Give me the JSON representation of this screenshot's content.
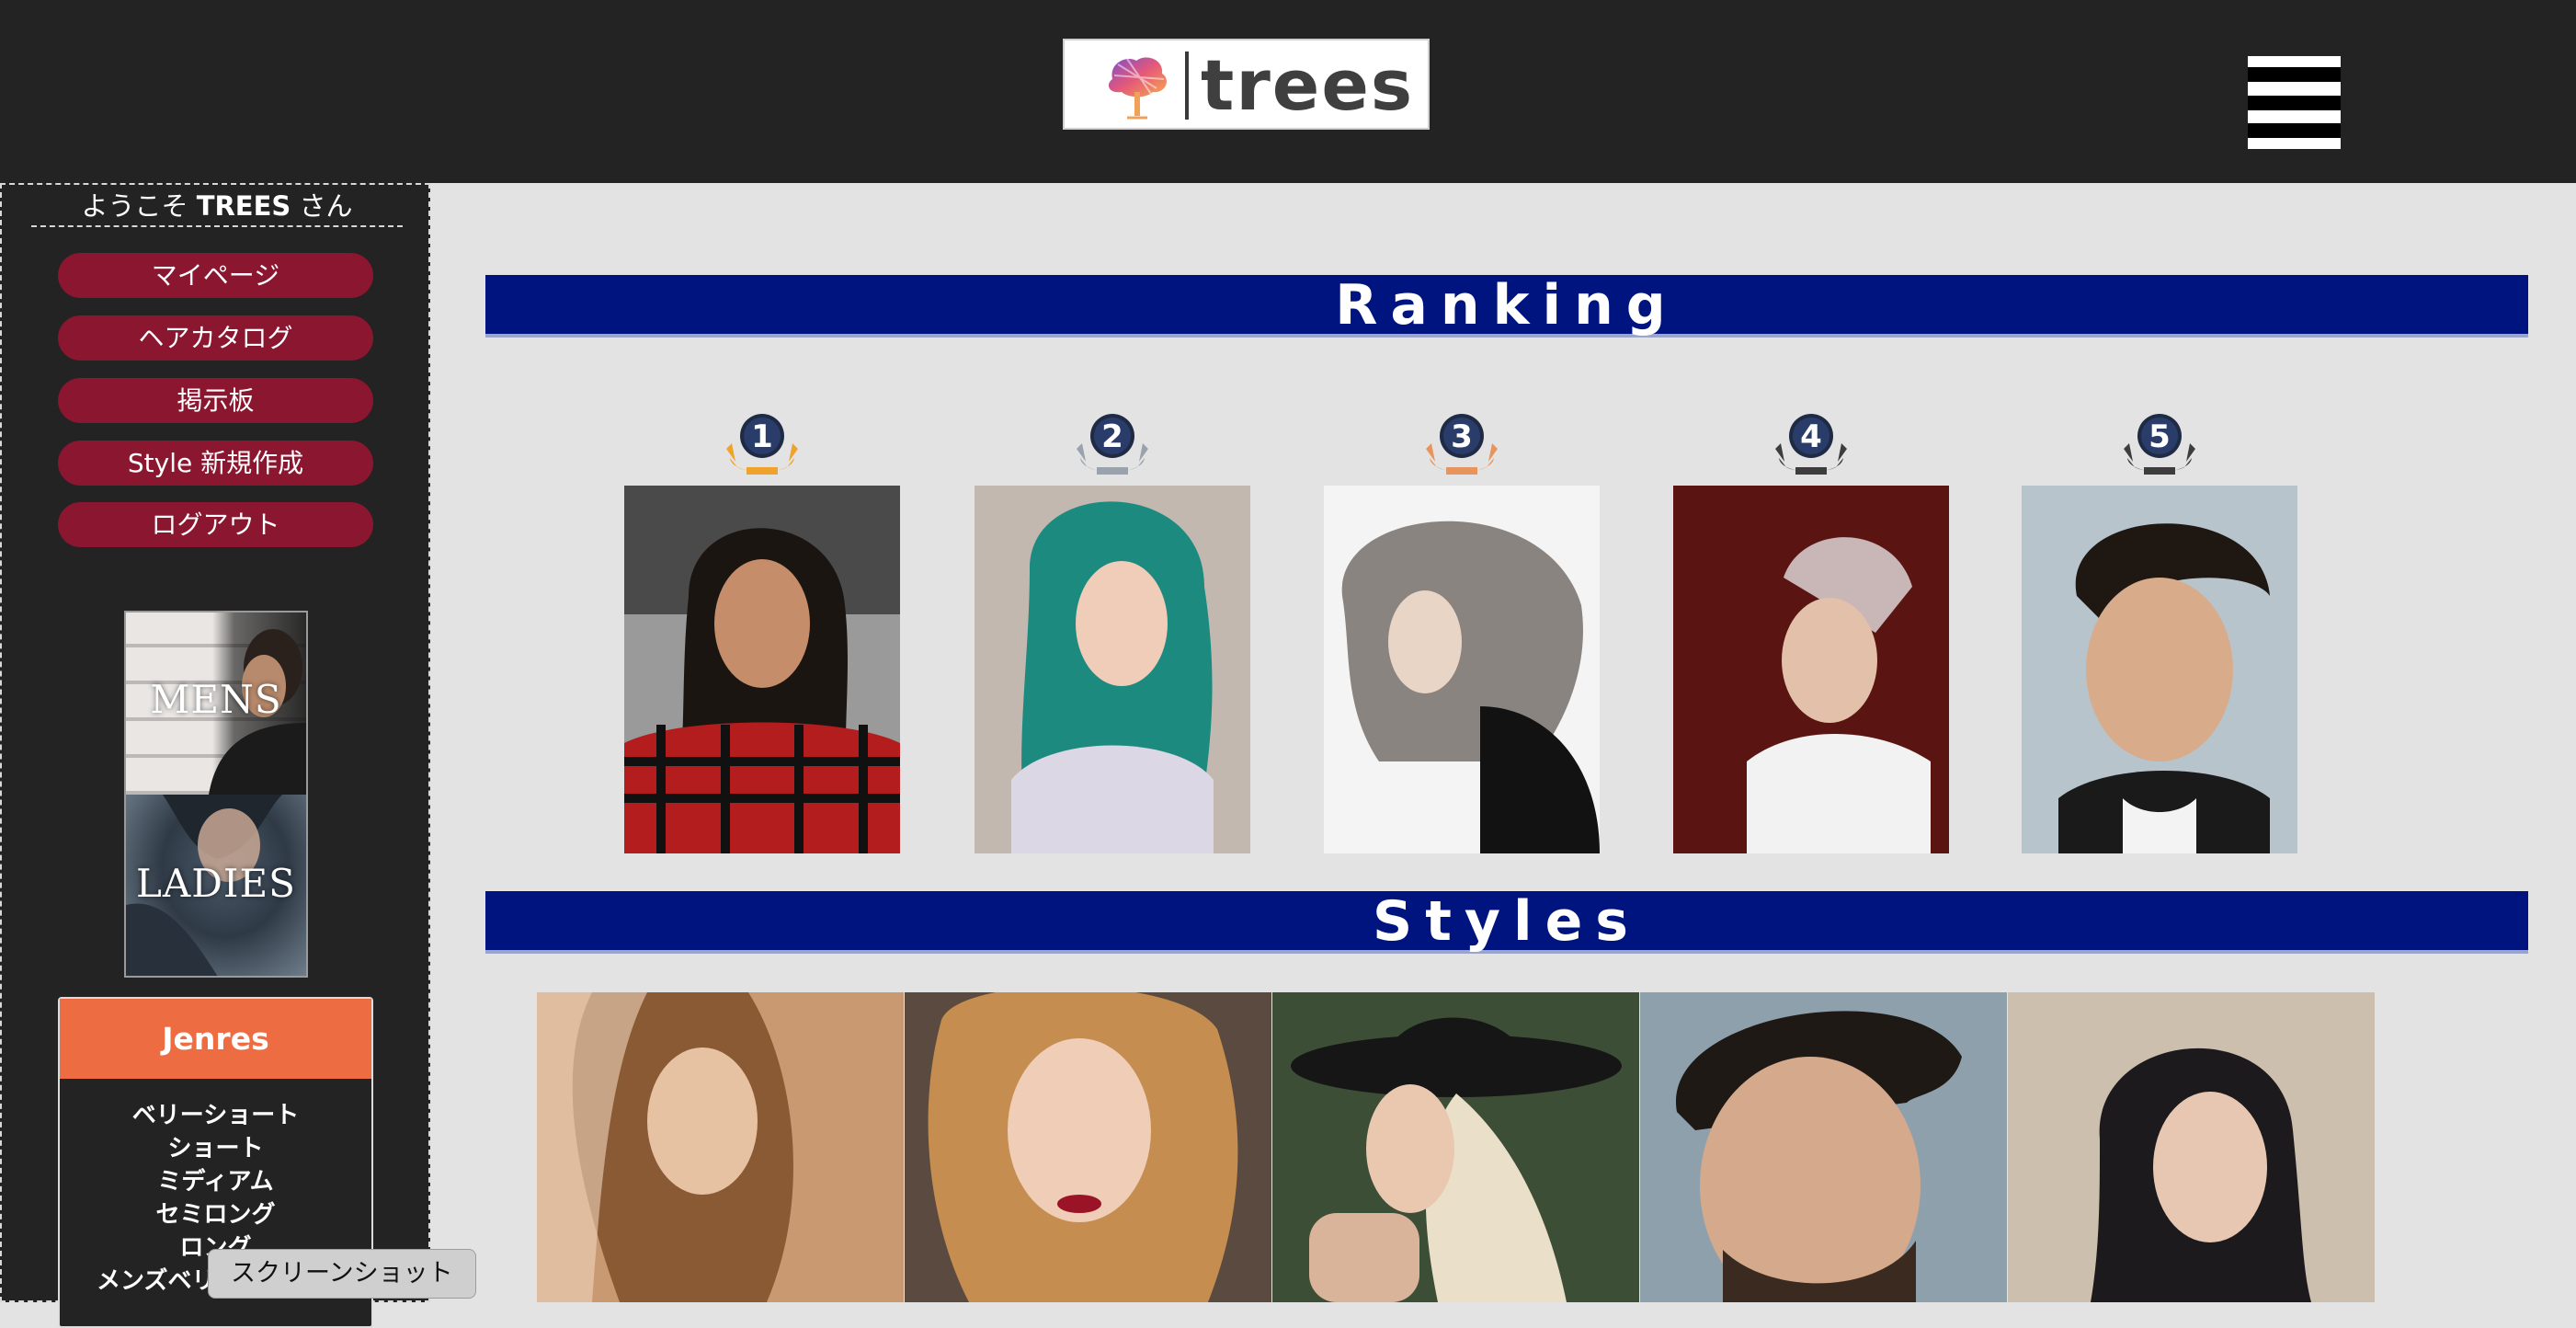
{
  "header": {
    "logo_text": "trees",
    "menu_icon": "hamburger-menu-icon"
  },
  "sidebar": {
    "welcome_prefix": "ようこそ",
    "welcome_user": "TREES",
    "welcome_suffix": "さん",
    "buttons": [
      "マイページ",
      "ヘアカタログ",
      "掲示板",
      "Style 新規作成",
      "ログアウト"
    ],
    "gender": {
      "mens": "MENS",
      "ladies": "LADIES"
    },
    "jenres": {
      "title": "Jenres",
      "items": [
        "ベリーショート",
        "ショート",
        "ミディアム",
        "セミロング",
        "ロング",
        "メンズベリーショート"
      ]
    }
  },
  "tooltip": "スクリーンショット",
  "ranking": {
    "title": "Ranking",
    "items": [
      {
        "rank": "1",
        "medal_color": "#f0a32c"
      },
      {
        "rank": "2",
        "medal_color": "#9aa3ad"
      },
      {
        "rank": "3",
        "medal_color": "#e7955c"
      },
      {
        "rank": "4",
        "medal_color": "#3d3d3d"
      },
      {
        "rank": "5",
        "medal_color": "#3d3d3d"
      }
    ]
  },
  "styles": {
    "title": "Styles"
  },
  "colors": {
    "header_bg": "#232323",
    "banner": "#001480",
    "sidebar_button": "#8a1630",
    "jenres_header": "#ee6c42",
    "page_bg": "#e3e3e3"
  }
}
